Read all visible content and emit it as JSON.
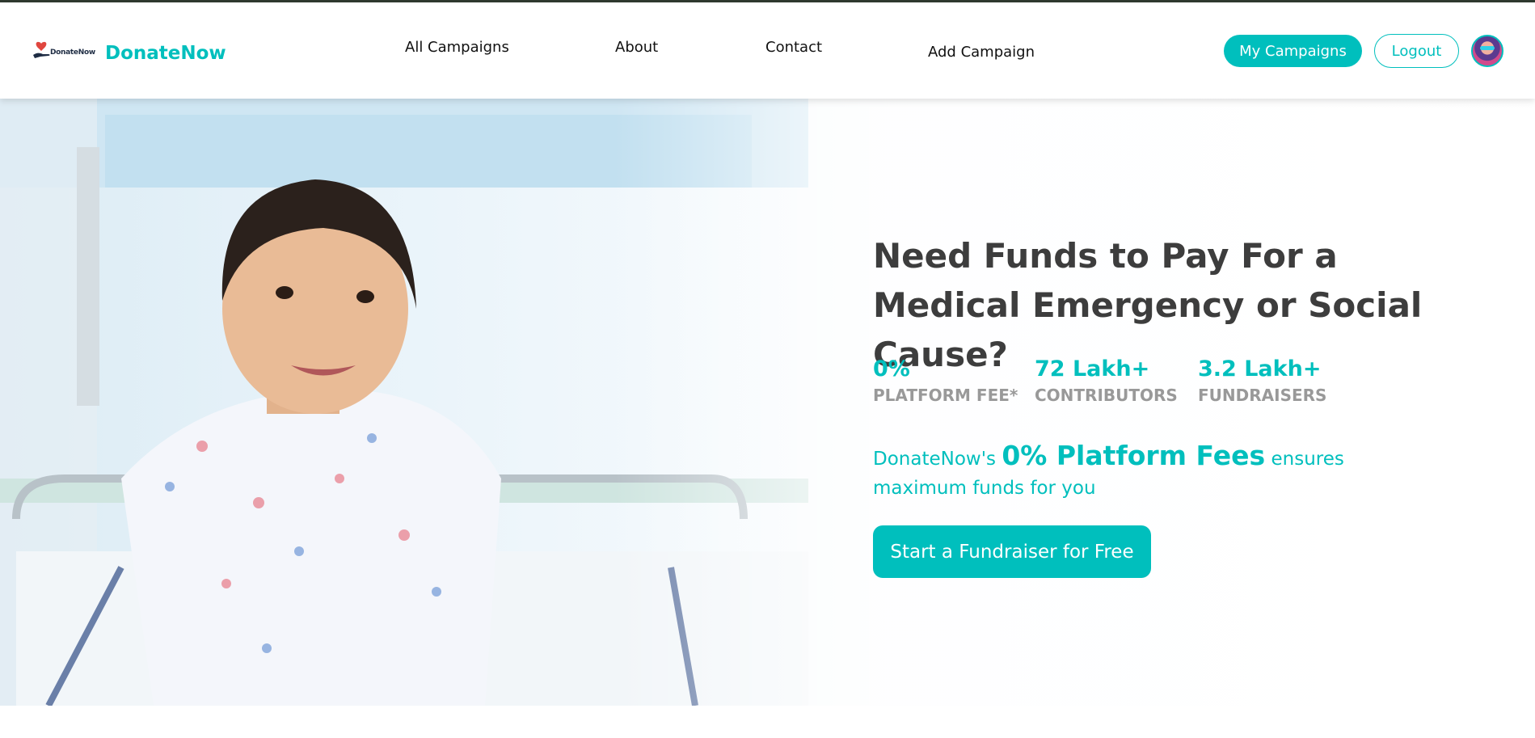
{
  "header": {
    "logo_text": "DonateNow",
    "brand": "DonateNow",
    "nav": [
      "All Campaigns",
      "About",
      "Contact",
      "Add Campaign"
    ],
    "my_campaigns": "My Campaigns",
    "logout": "Logout"
  },
  "hero": {
    "heading": "Need Funds to Pay For a Medical Emergency or Social Cause?",
    "stats": [
      {
        "value": "0%",
        "label": "PLATFORM FEE*"
      },
      {
        "value": "72 Lakh+",
        "label": "CONTRIBUTORS"
      },
      {
        "value": "3.2 Lakh+",
        "label": "FUNDRAISERS"
      }
    ],
    "tagline_prefix": "DonateNow's",
    "tagline_highlight": "0% Platform Fees",
    "tagline_suffix": "ensures maximum funds for you",
    "cta": "Start a Fundraiser for Free"
  },
  "colors": {
    "accent": "#00bfbd",
    "heading": "#3d3d3d",
    "label": "#999999"
  }
}
